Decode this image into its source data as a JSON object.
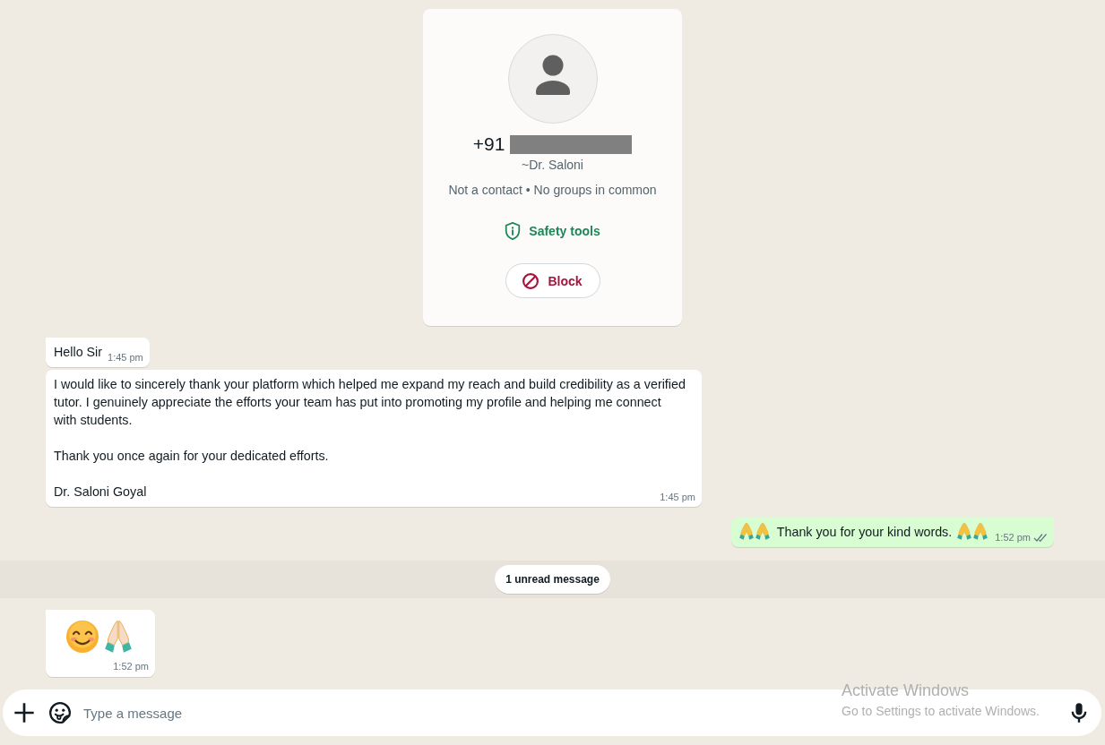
{
  "contact_card": {
    "phone_prefix": "+91",
    "phone_redacted": true,
    "push_name": "~Dr. Saloni",
    "info": "Not a contact • No groups in common",
    "safety_link": "Safety tools",
    "block_button": "Block"
  },
  "chat": [
    {
      "kind": "text",
      "outgoing": false,
      "tail": true,
      "paragraphs": [
        {
          "parts": [
            {
              "kind": "text",
              "text": "Hello Sir"
            }
          ]
        }
      ],
      "time": "1:45 pm"
    },
    {
      "kind": "text",
      "outgoing": false,
      "tail": false,
      "paragraphs": [
        {
          "parts": [
            {
              "kind": "text",
              "text": "I would like to sincerely thank your platform which helped me expand my reach and build credibility as a verified tutor. I genuinely appreciate the efforts your team has put into promoting my profile and helping me connect with students."
            }
          ]
        },
        {
          "parts": [
            {
              "kind": "text",
              "text": "Thank you once again for your dedicated efforts."
            }
          ]
        },
        {
          "parts": [
            {
              "kind": "text",
              "text": "Dr. Saloni Goyal"
            }
          ]
        }
      ],
      "time": "1:45 pm"
    },
    {
      "kind": "text",
      "outgoing": true,
      "tail": true,
      "paragraphs": [
        {
          "parts": [
            {
              "kind": "pray"
            },
            {
              "kind": "pray"
            },
            {
              "kind": "text",
              "text": "Thank you for your kind words."
            },
            {
              "kind": "pray"
            },
            {
              "kind": "pray"
            }
          ]
        }
      ],
      "time": "1:52 pm",
      "read": false
    },
    {
      "kind": "divider",
      "text": "1 unread message"
    },
    {
      "kind": "jumbo",
      "outgoing": false,
      "tail": true,
      "paragraphs": [
        {
          "parts": [
            {
              "kind": "smile"
            },
            {
              "kind": "palms"
            }
          ]
        }
      ],
      "time": "1:52 pm"
    }
  ],
  "composer": {
    "placeholder": "Type a message"
  },
  "os_overlay": {
    "title": "Activate Windows",
    "subtitle": "Go to Settings to activate Windows."
  }
}
